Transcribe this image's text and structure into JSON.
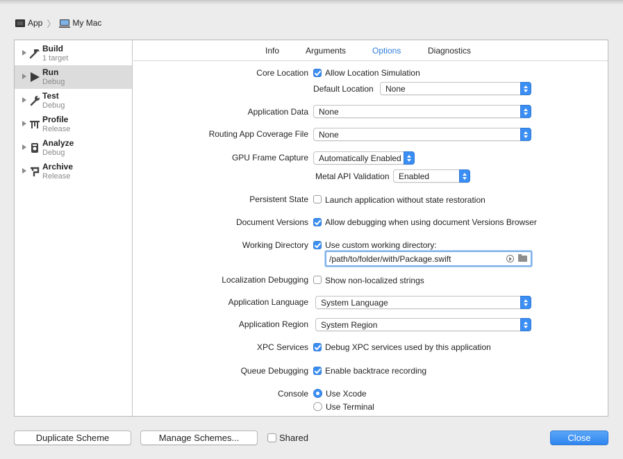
{
  "breadcrumb": {
    "app": "App",
    "destination": "My Mac"
  },
  "sidebar": {
    "items": [
      {
        "title": "Build",
        "subtitle": "1 target",
        "icon": "hammer-icon"
      },
      {
        "title": "Run",
        "subtitle": "Debug",
        "icon": "play-icon",
        "selected": true
      },
      {
        "title": "Test",
        "subtitle": "Debug",
        "icon": "wrench-icon"
      },
      {
        "title": "Profile",
        "subtitle": "Release",
        "icon": "instruments-icon"
      },
      {
        "title": "Analyze",
        "subtitle": "Debug",
        "icon": "analyze-icon"
      },
      {
        "title": "Archive",
        "subtitle": "Release",
        "icon": "archive-icon"
      }
    ]
  },
  "tabs": [
    {
      "label": "Info"
    },
    {
      "label": "Arguments"
    },
    {
      "label": "Options",
      "active": true
    },
    {
      "label": "Diagnostics"
    }
  ],
  "options": {
    "core_location": {
      "label": "Core Location",
      "checkbox": "Allow Location Simulation",
      "checked": true,
      "default_location_label": "Default Location",
      "default_location_value": "None"
    },
    "application_data": {
      "label": "Application Data",
      "value": "None"
    },
    "routing_coverage": {
      "label": "Routing App Coverage File",
      "value": "None"
    },
    "gpu_capture": {
      "label": "GPU Frame Capture",
      "value": "Automatically Enabled",
      "metal_label": "Metal API Validation",
      "metal_value": "Enabled"
    },
    "persistent_state": {
      "label": "Persistent State",
      "checkbox": "Launch application without state restoration",
      "checked": false
    },
    "document_versions": {
      "label": "Document Versions",
      "checkbox": "Allow debugging when using document Versions Browser",
      "checked": true
    },
    "working_directory": {
      "label": "Working Directory",
      "checkbox": "Use custom working directory:",
      "checked": true,
      "path": "/path/to/folder/with/Package.swift"
    },
    "localization": {
      "label": "Localization Debugging",
      "checkbox": "Show non-localized strings",
      "checked": false
    },
    "app_language": {
      "label": "Application Language",
      "value": "System Language"
    },
    "app_region": {
      "label": "Application Region",
      "value": "System Region"
    },
    "xpc": {
      "label": "XPC Services",
      "checkbox": "Debug XPC services used by this application",
      "checked": true
    },
    "queue": {
      "label": "Queue Debugging",
      "checkbox": "Enable backtrace recording",
      "checked": true
    },
    "console": {
      "label": "Console",
      "option1": "Use Xcode",
      "option2": "Use Terminal",
      "selected": "Use Xcode"
    }
  },
  "footer": {
    "duplicate": "Duplicate Scheme",
    "manage": "Manage Schemes...",
    "shared": "Shared",
    "close": "Close"
  },
  "colors": {
    "accent": "#3b8ef3",
    "selected_row": "#dcdcdc",
    "active_tab": "#2f7cd9"
  }
}
